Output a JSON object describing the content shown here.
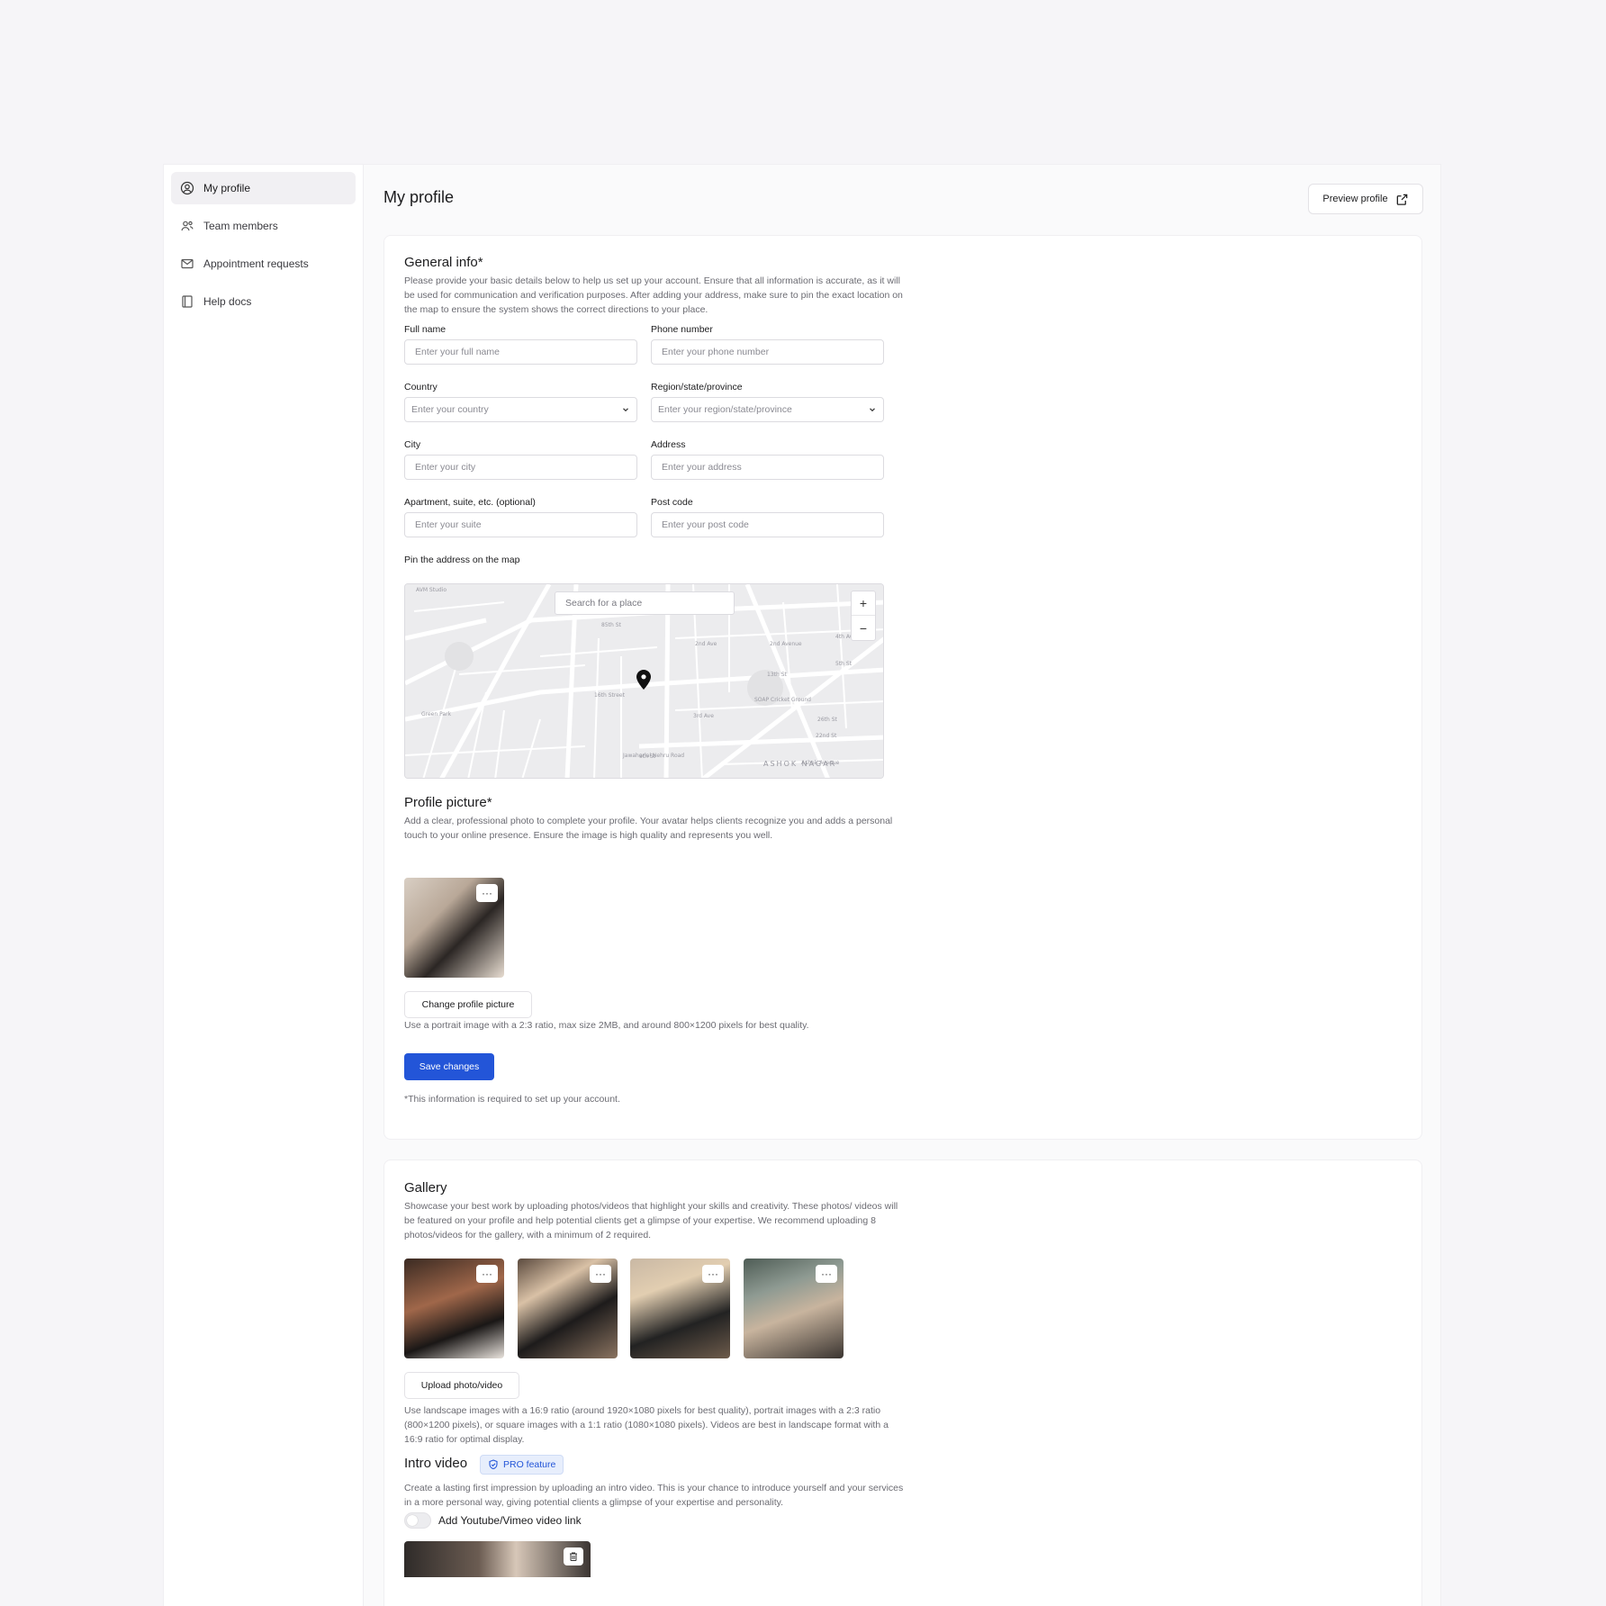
{
  "sidebar": {
    "items": [
      {
        "label": "My profile",
        "icon": "user-circle-icon",
        "active": true
      },
      {
        "label": "Team members",
        "icon": "users-icon",
        "active": false
      },
      {
        "label": "Appointment requests",
        "icon": "mail-icon",
        "active": false
      },
      {
        "label": "Help docs",
        "icon": "book-icon",
        "active": false
      }
    ]
  },
  "header": {
    "title": "My profile",
    "preview_label": "Preview profile"
  },
  "general": {
    "title": "General info*",
    "description": "Please provide your basic details below to help us set up your account. Ensure that all information is accurate, as it will be used for communication and verification purposes. After adding your address, make sure to pin the exact location on the map to ensure the system shows the correct directions to your place.",
    "fields": {
      "full_name": {
        "label": "Full name",
        "placeholder": "Enter your full name"
      },
      "phone": {
        "label": "Phone number",
        "placeholder": "Enter your phone number"
      },
      "country": {
        "label": "Country",
        "placeholder": "Enter your country"
      },
      "region": {
        "label": "Region/state/province",
        "placeholder": "Enter your region/state/province"
      },
      "city": {
        "label": "City",
        "placeholder": "Enter your city"
      },
      "address": {
        "label": "Address",
        "placeholder": "Enter your address"
      },
      "suite": {
        "label": "Apartment, suite, etc. (optional)",
        "placeholder": "Enter your suite"
      },
      "postcode": {
        "label": "Post code",
        "placeholder": "Enter your post code"
      }
    },
    "map": {
      "label": "Pin the address on the map",
      "search_placeholder": "Search for a place",
      "zoom_in": "+",
      "zoom_out": "−",
      "street_labels": [
        "AVM Studio",
        "85th St",
        "2nd Ave",
        "2nd Avenue",
        "13th St",
        "16th Street",
        "3rd Ave",
        "SOAP Cricket Ground",
        "26th St",
        "22nd St",
        "Green Park",
        "ASHOK NAGAR",
        "Jawaharlal Nehru Road",
        "Ashok Avenue",
        "4th Ave",
        "5th St",
        "9th St"
      ]
    }
  },
  "profile_picture": {
    "title": "Profile picture*",
    "description": "Add a clear, professional photo to complete your profile. Your avatar helps clients recognize you and adds a personal touch to your online presence. Ensure the image is high quality and represents you well.",
    "more_label": "···",
    "change_label": "Change profile picture",
    "hint": "Use a portrait image with a 2:3 ratio, max size 2MB, and around 800×1200 pixels for best quality."
  },
  "save": {
    "label": "Save changes",
    "note": "*This information is required to set up your account."
  },
  "gallery": {
    "title": "Gallery",
    "description": "Showcase your best work by uploading photos/videos that highlight your skills and creativity. These photos/ videos will be featured on your profile and help potential clients get a glimpse of your expertise. We recommend uploading 8 photos/videos for the gallery, with a minimum of 2 required.",
    "more_label": "···",
    "upload_label": "Upload photo/video",
    "hint": "Use landscape images with a 16:9 ratio (around 1920×1080 pixels for best quality), portrait images with a 2:3 ratio (800×1200 pixels), or square images with a 1:1 ratio (1080×1080 pixels). Videos are best in landscape format with a 16:9 ratio for optimal display."
  },
  "intro_video": {
    "title": "Intro video",
    "badge": "PRO feature",
    "description": "Create a lasting first impression by uploading an intro video. This is your chance to introduce yourself and your services in a more personal way, giving potential clients a glimpse of your expertise and personality.",
    "toggle_label": "Add Youtube/Vimeo video link",
    "toggle_on": false
  },
  "colors": {
    "accent": "#2355d8",
    "background": "#f6f5f8",
    "badge_bg": "#e7eefc"
  }
}
